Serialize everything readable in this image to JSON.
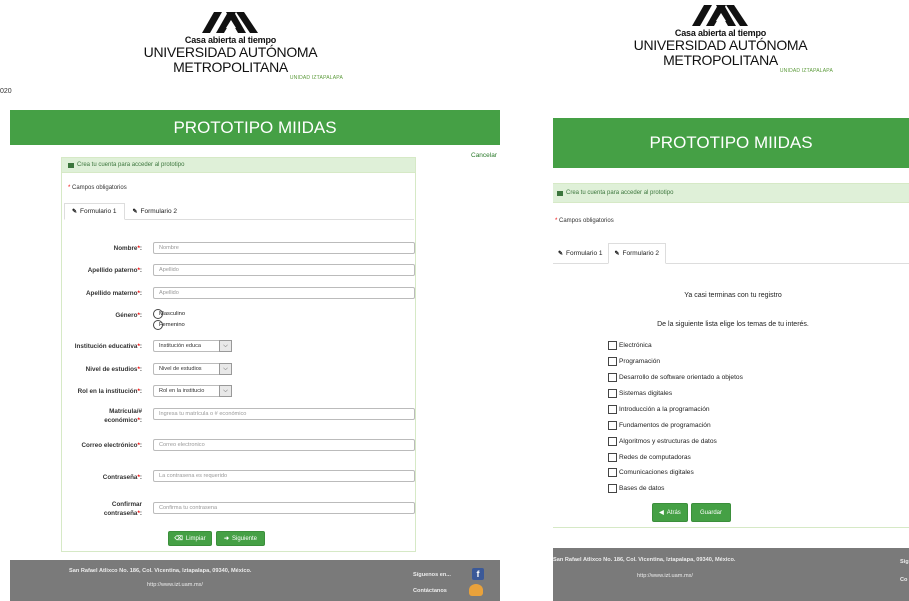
{
  "left": {
    "partial_year": "020",
    "logo": {
      "line1": "Casa abierta al tiempo",
      "line2": "UNIVERSIDAD AUTÓNOMA METROPOLITANA",
      "line3": "UNIDAD IZTAPALAPA"
    },
    "banner_title": "PROTOTIPO MIIDAS",
    "cancel_link": "Cancelar",
    "card_header": "Crea tu cuenta para acceder al prototipo",
    "required_note": "Campos obligatorios",
    "tabs": [
      "Formulario 1",
      "Formulario 2"
    ],
    "fields": {
      "nombre": {
        "label": "Nombre",
        "placeholder": "Nombre"
      },
      "apellido_paterno": {
        "label": "Apellido paterno",
        "placeholder": "Apellido"
      },
      "apellido_materno": {
        "label": "Apellido materno",
        "placeholder": "Apellido"
      },
      "genero": {
        "label": "Género",
        "options": [
          "Masculino",
          "Femenino"
        ]
      },
      "institucion": {
        "label": "Institución educativa",
        "value": "Institución educa"
      },
      "nivel": {
        "label": "Nivel de estudios",
        "value": "Nivel de estudios"
      },
      "rol": {
        "label": "Rol en la institución",
        "value": "Rol en la institucio"
      },
      "matricula": {
        "label_a": "Matrícula/#",
        "label_b": "económico",
        "placeholder": "Ingresa tu matrícula o # económico"
      },
      "correo": {
        "label": "Correo electrónico",
        "placeholder": "Correo electronico"
      },
      "contrasena": {
        "label": "Contraseña",
        "placeholder": "La contrasena es requerido"
      },
      "confirmar": {
        "label_a": "Confirmar",
        "label_b": "contraseña",
        "placeholder": "Confirma tu contrasena"
      }
    },
    "buttons": {
      "limpiar": "Limpiar",
      "siguiente": "Siguiente"
    },
    "footer": {
      "address": "San Rafael Atlixco No. 186, Col. Vicentina, Iztapalapa, 09340, México.",
      "url": "http://www.izt.uam.mx/",
      "siguenos": "Síguenos en...",
      "contactanos": "Contáctanos"
    }
  },
  "right": {
    "logo": {
      "line1": "Casa abierta al tiempo",
      "line2": "UNIVERSIDAD AUTÓNOMA METROPOLITANA",
      "line3": "UNIDAD IZTAPALAPA"
    },
    "banner_title": "PROTOTIPO MIIDAS",
    "card_header": "Crea tu cuenta para acceder al prototipo",
    "required_note": "Campos obligatorios",
    "tabs": [
      "Formulario 1",
      "Formulario 2"
    ],
    "message1": "Ya casi terminas con tu registro",
    "message2": "De la siguiente lista elige los temas de tu interés.",
    "topics": [
      "Electrónica",
      "Programación",
      "Desarrollo de software orientado a objetos",
      "Sistemas digitales",
      "Introducción a la programación",
      "Fundamentos de programación",
      "Algoritmos y estructuras de datos",
      "Redes de computadoras",
      "Comunicaciones digitales",
      "Bases de datos"
    ],
    "buttons": {
      "atras": "Atrás",
      "guardar": "Guardar"
    },
    "footer": {
      "address": "San Rafael Atlixco No. 186, Col. Vicentina, Iztapalapa, 09340, México.",
      "url": "http://www.izt.uam.mx/",
      "right_top": "Sig",
      "right_bottom": "Co"
    }
  },
  "colors": {
    "green": "#45a045",
    "card_header_bg": "#dff0d8",
    "footer_gray": "#7a7a7a",
    "required": "#e00000"
  }
}
